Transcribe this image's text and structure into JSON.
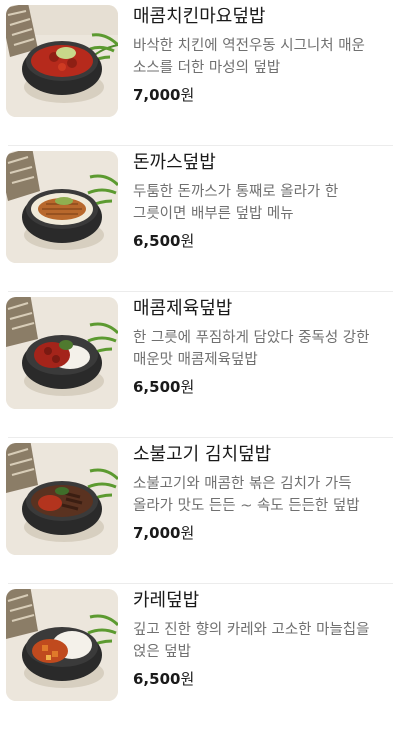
{
  "menu": {
    "items": [
      {
        "name": "매콤치킨마요덮밥",
        "description": "바삭한 치킨에 역전우동 시그니처 매운 소스를 더한 마성의 덮밥",
        "price": "7,000",
        "currency": "원",
        "image_icon": "spicy-chicken-mayo-rice-bowl",
        "topping_color": "#b62a1c",
        "garnish_color": "#c8d88a"
      },
      {
        "name": "돈까스덮밥",
        "description": "두툼한 돈까스가 통째로 올라가 한 그릇이면 배부른 덮밥 메뉴",
        "price": "6,500",
        "currency": "원",
        "image_icon": "pork-cutlet-rice-bowl",
        "topping_color": "#b8682c",
        "garnish_color": "#8fb050"
      },
      {
        "name": "매콤제육덮밥",
        "description": "한 그릇에 푸짐하게 담았다 중독성 강한 매운맛 매콤제육덮밥",
        "price": "6,500",
        "currency": "원",
        "image_icon": "spicy-pork-rice-bowl",
        "topping_color": "#a4241a",
        "garnish_color": "#4f7a2f"
      },
      {
        "name": "소불고기 김치덮밥",
        "description": "소불고기와 매콤한 볶은 김치가 가득 올라가 맛도 든든 ~ 속도 든든한 덮밥",
        "price": "7,000",
        "currency": "원",
        "image_icon": "beef-bulgogi-kimchi-rice-bowl",
        "topping_color": "#5a3220",
        "garnish_color": "#3f6e2a"
      },
      {
        "name": "카레덮밥",
        "description": "깊고 진한 향의 카레와 고소한 마늘칩을 얹은 덮밥",
        "price": "6,500",
        "currency": "원",
        "image_icon": "curry-rice-bowl",
        "topping_color": "#c04a1e",
        "garnish_color": "#f4f1ea"
      }
    ]
  }
}
